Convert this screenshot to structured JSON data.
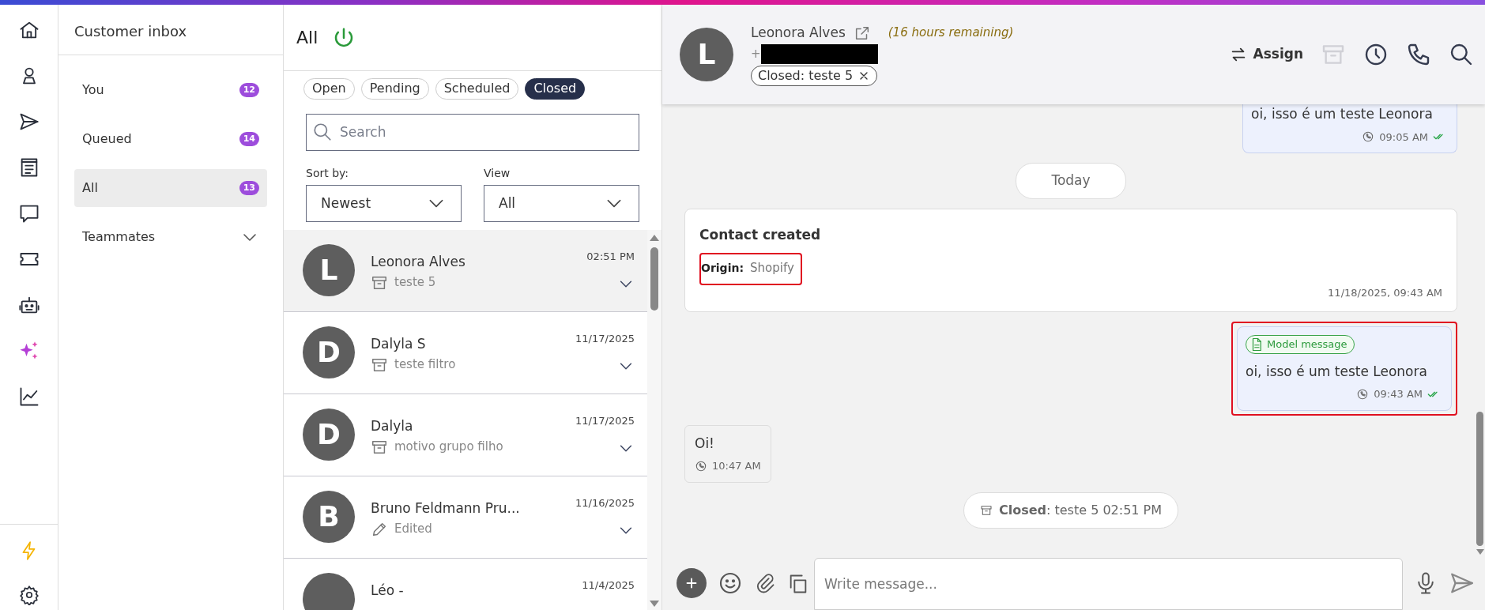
{
  "sidebar": {
    "title": "Customer inbox",
    "items": [
      {
        "kind": "queue",
        "label": "You",
        "count": "12",
        "selected": false
      },
      {
        "kind": "queue",
        "label": "Queued",
        "count": "14",
        "selected": false
      },
      {
        "kind": "queue",
        "label": "All",
        "count": "13",
        "selected": true
      },
      {
        "kind": "group",
        "label": "Teammates",
        "selected": false,
        "expanded": false
      }
    ]
  },
  "list": {
    "title": "All",
    "online": true,
    "filters": [
      {
        "label": "Open",
        "selected": false
      },
      {
        "label": "Pending",
        "selected": false
      },
      {
        "label": "Scheduled",
        "selected": false
      },
      {
        "label": "Closed",
        "selected": true
      }
    ],
    "search": {
      "placeholder": "Search"
    },
    "sort": {
      "label": "Sort by:",
      "value": "Newest"
    },
    "view": {
      "label": "View",
      "value": "All"
    },
    "conversations": [
      {
        "initial": "L",
        "name": "Leonora Alves",
        "time": "02:51 PM",
        "preview": {
          "kind": "archived",
          "text": "teste 5"
        },
        "selected": true
      },
      {
        "initial": "D",
        "name": "Dalyla S",
        "time": "11/17/2025",
        "preview": {
          "kind": "archived",
          "text": "teste filtro"
        },
        "selected": false
      },
      {
        "initial": "D",
        "name": "Dalyla",
        "time": "11/17/2025",
        "preview": {
          "kind": "archived",
          "text": "motivo grupo filho"
        },
        "selected": false
      },
      {
        "initial": "B",
        "name": "Bruno Feldmann Pru...",
        "time": "11/16/2025",
        "preview": {
          "kind": "edited",
          "text": "Edited"
        },
        "selected": false
      },
      {
        "name": "Léo -",
        "time": "11/4/2025",
        "selected": false
      }
    ]
  },
  "chat": {
    "contact": {
      "initial": "L",
      "name": "Leonora Alves",
      "window_note": "(16 hours remaining)",
      "phone": "+",
      "status_tag": "Closed: teste 5"
    },
    "actions": [
      {
        "kind": "assign",
        "label": "Assign",
        "disabled": false
      },
      {
        "kind": "archive",
        "disabled": true
      },
      {
        "kind": "snooze",
        "disabled": false
      },
      {
        "kind": "call",
        "disabled": false
      },
      {
        "kind": "search",
        "disabled": false
      }
    ],
    "messages": [
      {
        "kind": "outgoing",
        "text": "oi, isso é um teste Leonora",
        "time": "09:05 AM",
        "read": true,
        "highlighted": false,
        "cut": true
      },
      {
        "kind": "date",
        "text": "Today"
      },
      {
        "kind": "event",
        "title": "Contact created",
        "fields": [
          {
            "label": "Origin:",
            "value": "Shopify",
            "highlighted": true
          }
        ],
        "time": "11/18/2025, 09:43 AM"
      },
      {
        "kind": "outgoing",
        "tag": "Model message",
        "text": "oi, isso é um teste Leonora",
        "time": "09:43 AM",
        "read": true,
        "highlighted": true,
        "cut": false
      },
      {
        "kind": "incoming",
        "text": "Oi!",
        "time": "10:47 AM"
      },
      {
        "kind": "status",
        "text": "**Closed**: teste 5 02:51 PM"
      }
    ],
    "composer": {
      "placeholder": "Write message..."
    }
  }
}
